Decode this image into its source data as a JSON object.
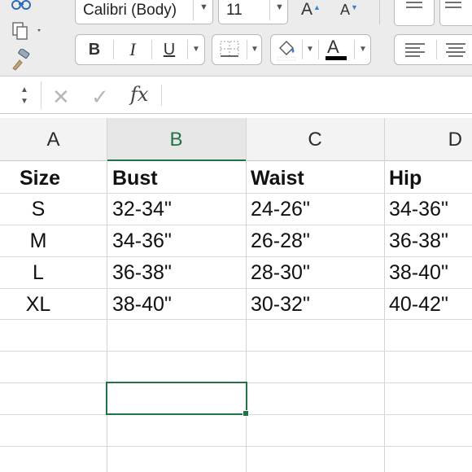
{
  "ribbon": {
    "font_name": "Calibri (Body)",
    "font_size": "11",
    "grow_font_label": "A",
    "shrink_font_label": "A",
    "bold_label": "B",
    "italic_label": "I",
    "underline_label": "U",
    "font_color_label": "A",
    "font_color": "#000000",
    "icons": [
      "binoculars-icon",
      "copy-icon",
      "format-painter-icon",
      "borders-icon",
      "fill-color-icon",
      "align-left-icon",
      "align-center-icon"
    ]
  },
  "formula_bar": {
    "cancel_glyph": "✕",
    "enter_glyph": "✓",
    "fx_label": "fx",
    "value": ""
  },
  "sheet": {
    "columns": [
      "A",
      "B",
      "C",
      "D"
    ],
    "selected_column": "B",
    "accent_color": "#217346",
    "rows": [
      [
        "Size",
        "Bust",
        "Waist",
        "Hip"
      ],
      [
        "S",
        "32-34\"",
        "24-26\"",
        "34-36\""
      ],
      [
        "M",
        "34-36\"",
        "26-28\"",
        "36-38\""
      ],
      [
        "L",
        "36-38\"",
        "28-30\"",
        "38-40\""
      ],
      [
        "XL",
        "38-40\"",
        "30-32\"",
        "40-42\""
      ]
    ]
  }
}
